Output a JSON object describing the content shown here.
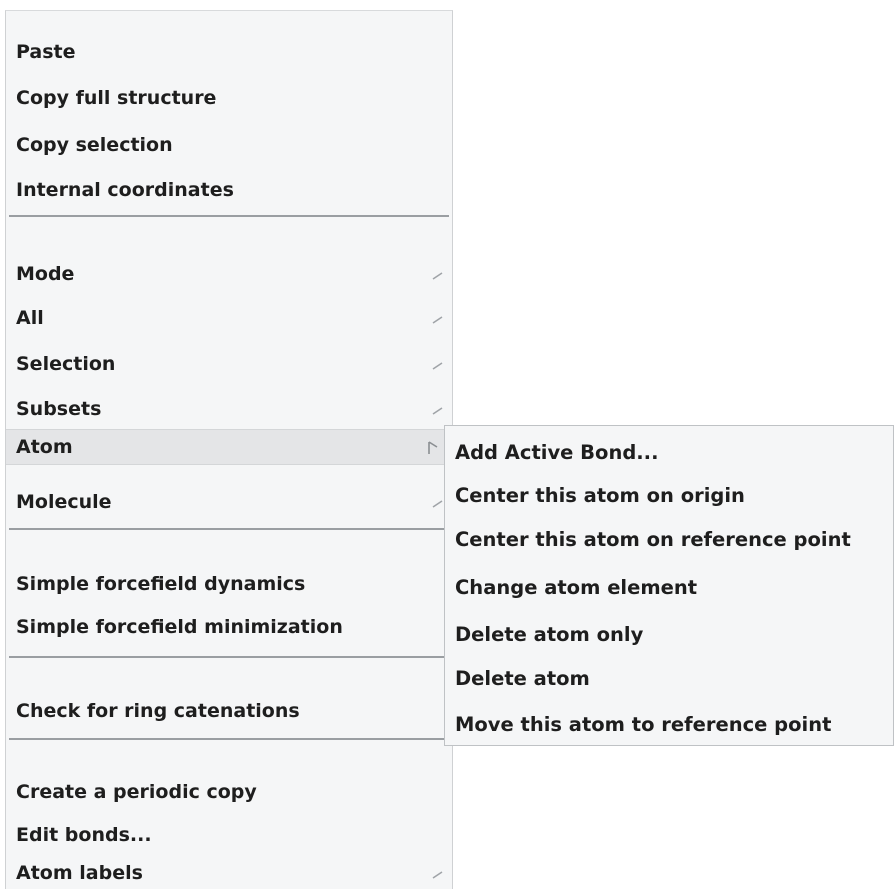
{
  "main_menu": {
    "items": [
      {
        "label": "Paste"
      },
      {
        "label": "Copy full structure"
      },
      {
        "label": "Copy selection"
      },
      {
        "label": "Internal coordinates"
      },
      {
        "label": "Mode",
        "submenu": true
      },
      {
        "label": "All",
        "submenu": true
      },
      {
        "label": "Selection",
        "submenu": true
      },
      {
        "label": "Subsets",
        "submenu": true
      },
      {
        "label": "Atom",
        "submenu": true,
        "active": true
      },
      {
        "label": "Molecule",
        "submenu": true
      },
      {
        "label": "Simple forcefield dynamics"
      },
      {
        "label": "Simple forcefield minimization"
      },
      {
        "label": "Check for ring catenations"
      },
      {
        "label": "Create a periodic copy"
      },
      {
        "label": "Edit bonds..."
      },
      {
        "label": "Atom labels",
        "submenu": true
      }
    ]
  },
  "atom_submenu": {
    "items": [
      {
        "label": "Add Active Bond..."
      },
      {
        "label": "Center this atom on origin"
      },
      {
        "label": "Center this atom on reference point"
      },
      {
        "label": "Change atom element"
      },
      {
        "label": "Delete atom only"
      },
      {
        "label": "Delete atom"
      },
      {
        "label": "Move this atom to reference point"
      }
    ]
  },
  "colors": {
    "menu_background": "#f5f6f7",
    "active_item_background": "#e4e5e7",
    "text": "#1e1e1e",
    "separator": "#9a9ea2"
  }
}
